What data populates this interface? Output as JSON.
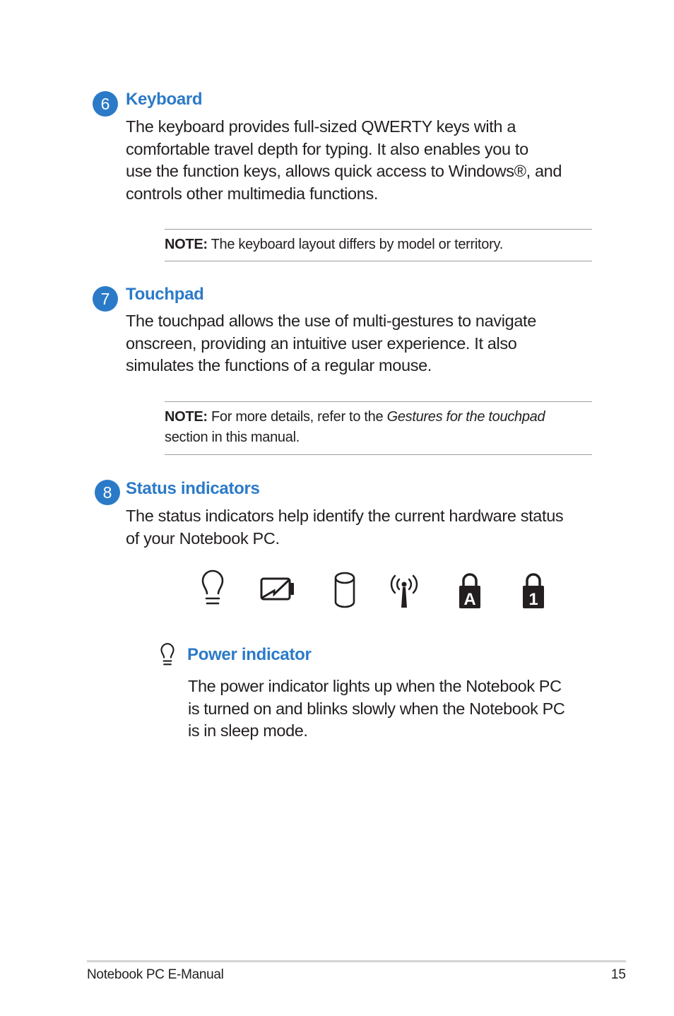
{
  "accent_color": "#2b7ac8",
  "sections": [
    {
      "number": "6",
      "title": "Keyboard",
      "body_lines": [
        "The keyboard provides full-sized QWERTY keys with a",
        "comfortable travel depth for typing. It also enables you to",
        "use the function keys, allows quick access to Windows®, and",
        "controls other multimedia functions."
      ],
      "note": {
        "label": "NOTE:",
        "text": " The keyboard layout differs by model or territory."
      }
    },
    {
      "number": "7",
      "title": "Touchpad",
      "body_lines": [
        "The touchpad allows the use of multi-gestures to navigate",
        "onscreen, providing an intuitive user experience. It also",
        "simulates the functions of a regular mouse."
      ],
      "note": {
        "label": "NOTE:",
        "text_before": " For more details, refer to the ",
        "italic": "Gestures for the touchpad",
        "text_after": "section in this manual."
      }
    },
    {
      "number": "8",
      "title": "Status indicators",
      "body_lines": [
        "The status indicators help identify the current hardware status",
        "of your Notebook PC."
      ],
      "indicator_icons": [
        "power-bulb-icon",
        "battery-charge-icon",
        "drive-activity-icon",
        "wireless-icon",
        "caps-lock-icon",
        "num-lock-icon"
      ],
      "caps_lock_glyph": "A",
      "num_lock_glyph": "1",
      "subsection": {
        "icon": "power-bulb-icon",
        "title": "Power indicator",
        "body_lines": [
          "The power indicator lights up when the Notebook PC",
          "is turned on and blinks slowly when the Notebook PC",
          "is in sleep mode."
        ]
      }
    }
  ],
  "footer": {
    "title": "Notebook PC E-Manual",
    "page_number": "15"
  }
}
